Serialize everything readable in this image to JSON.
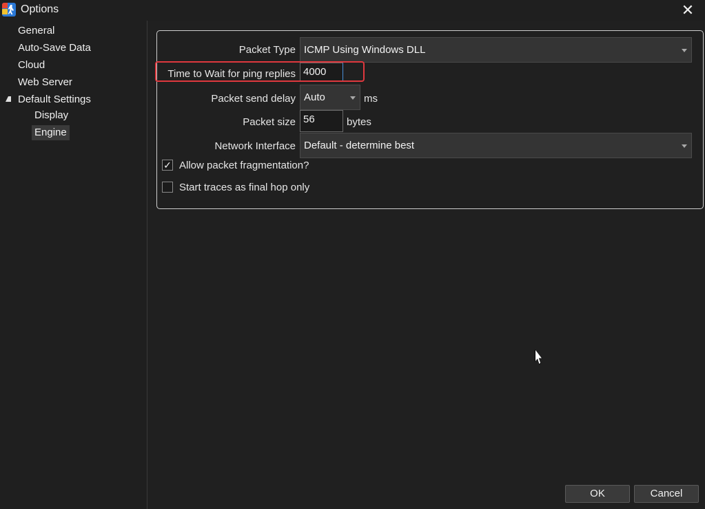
{
  "window": {
    "title": "Options",
    "close_glyph": "✕"
  },
  "sidebar": {
    "items": [
      {
        "label": "General"
      },
      {
        "label": "Auto-Save Data"
      },
      {
        "label": "Cloud"
      },
      {
        "label": "Web Server"
      },
      {
        "label": "Default Settings",
        "expanded": true
      },
      {
        "label": "Display"
      },
      {
        "label": "Engine",
        "selected": true
      }
    ]
  },
  "form": {
    "packet_type": {
      "label": "Packet Type",
      "value": "ICMP Using Windows DLL"
    },
    "wait_time": {
      "label": "Time to Wait for ping replies",
      "value": "4000"
    },
    "send_delay": {
      "label": "Packet send delay",
      "value": "Auto",
      "unit": "ms"
    },
    "packet_size": {
      "label": "Packet size",
      "value": "56",
      "unit": "bytes"
    },
    "network_interface": {
      "label": "Network Interface",
      "value": "Default - determine best"
    },
    "allow_fragmentation": {
      "label": "Allow packet fragmentation?",
      "checked": true,
      "check_glyph": "✓"
    },
    "final_hop_only": {
      "label": "Start traces as final hop only",
      "checked": false
    }
  },
  "buttons": {
    "ok": "OK",
    "cancel": "Cancel"
  },
  "colors": {
    "background": "#202020",
    "highlight": "#e0383e",
    "accent": "#2a78d6"
  }
}
